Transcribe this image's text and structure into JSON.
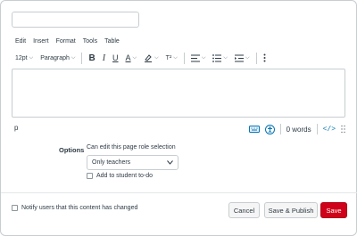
{
  "title_input": {
    "value": "",
    "placeholder": ""
  },
  "menubar": {
    "edit": "Edit",
    "insert": "Insert",
    "format": "Format",
    "tools": "Tools",
    "table": "Table"
  },
  "toolbar": {
    "font_size": "12pt",
    "block_format": "Paragraph",
    "bold": "B",
    "italic": "I",
    "underline": "U",
    "text_color": "A",
    "superscript": "T²",
    "accent_color": "#2d3b45"
  },
  "editor": {
    "content": ""
  },
  "statusbar": {
    "path": "p",
    "word_count": "0 words",
    "html_toggle": "</>",
    "icon_color": "#0374b5"
  },
  "options": {
    "label": "Options",
    "permission_label": "Can edit this page role selection",
    "permission_selected": "Only teachers",
    "todo_label": "Add to student to-do"
  },
  "footer": {
    "notify_label": "Notify users that this content has changed",
    "cancel": "Cancel",
    "save_publish": "Save & Publish",
    "save": "Save",
    "save_color": "#d0021b"
  }
}
